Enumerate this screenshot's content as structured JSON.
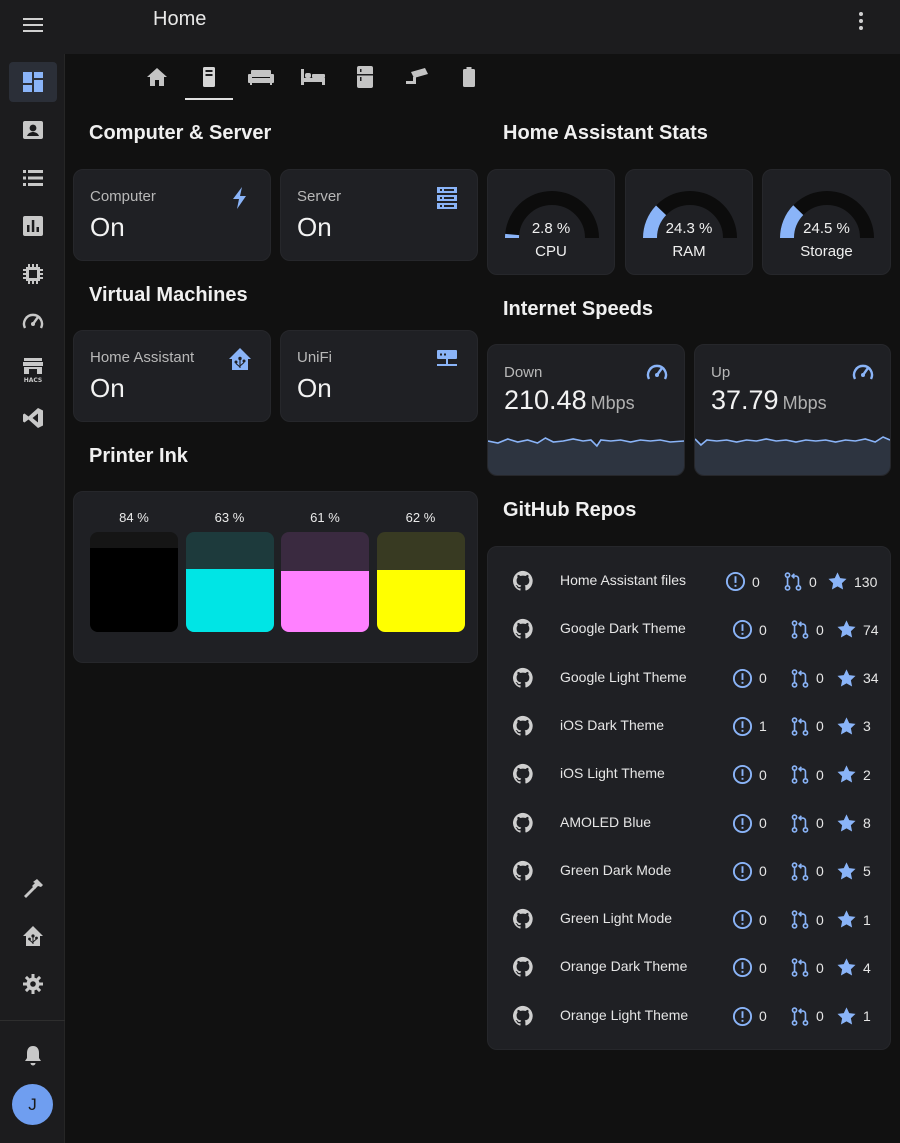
{
  "header": {
    "title": "Home",
    "menu_icon": "hamburger-menu-icon",
    "more_icon": "kebab-more-icon"
  },
  "sidebar": {
    "items": [
      {
        "icon": "dashboard-icon",
        "active": true
      },
      {
        "icon": "person-card-icon"
      },
      {
        "icon": "list-icon"
      },
      {
        "icon": "bar-chart-icon"
      },
      {
        "icon": "chip-icon"
      },
      {
        "icon": "speedometer-icon"
      },
      {
        "icon": "hacs-store-icon",
        "label": "HACS"
      },
      {
        "icon": "vscode-icon"
      }
    ],
    "bottom_items": [
      {
        "icon": "hammer-icon"
      },
      {
        "icon": "home-assistant-icon"
      },
      {
        "icon": "gear-icon"
      },
      {
        "icon": "bell-icon"
      }
    ],
    "avatar_initial": "J"
  },
  "tabs": [
    {
      "icon": "home-icon"
    },
    {
      "icon": "tower-pc-icon",
      "active": true
    },
    {
      "icon": "sofa-icon"
    },
    {
      "icon": "bed-icon"
    },
    {
      "icon": "fridge-icon"
    },
    {
      "icon": "cctv-icon"
    },
    {
      "icon": "battery-icon"
    }
  ],
  "computer_server": {
    "title": "Computer & Server",
    "tiles": [
      {
        "name": "Computer",
        "state": "On",
        "icon": "lightning-bolt-icon"
      },
      {
        "name": "Server",
        "state": "On",
        "icon": "server-icon"
      }
    ]
  },
  "virtual_machines": {
    "title": "Virtual Machines",
    "tiles": [
      {
        "name": "Home Assistant",
        "state": "On",
        "icon": "home-assistant-icon"
      },
      {
        "name": "UniFi",
        "state": "On",
        "icon": "network-icon"
      }
    ]
  },
  "printer_ink": {
    "title": "Printer Ink",
    "inks": [
      {
        "label": "84 %",
        "level": 0.84,
        "color": "#000000",
        "bg": "#151515"
      },
      {
        "label": "63 %",
        "level": 0.63,
        "color": "#00e5e5",
        "bg": "#1d3a3c"
      },
      {
        "label": "61 %",
        "level": 0.61,
        "color": "#ff80ff",
        "bg": "#3a2a40"
      },
      {
        "label": "62 %",
        "level": 0.62,
        "color": "#ffff00",
        "bg": "#383a22"
      }
    ]
  },
  "stats": {
    "title": "Home Assistant Stats",
    "gauges": [
      {
        "value_label": "2.8 %",
        "value": 2.8,
        "label": "CPU"
      },
      {
        "value_label": "24.3 %",
        "value": 24.3,
        "label": "RAM"
      },
      {
        "value_label": "24.5 %",
        "value": 24.5,
        "label": "Storage"
      }
    ]
  },
  "internet": {
    "title": "Internet Speeds",
    "speeds": [
      {
        "name": "Down",
        "value": "210.48",
        "unit": "Mbps",
        "icon": "speedometer-icon"
      },
      {
        "name": "Up",
        "value": "37.79",
        "unit": "Mbps",
        "icon": "speedometer-icon"
      }
    ]
  },
  "github": {
    "title": "GitHub Repos",
    "icons": {
      "repo": "github-icon",
      "issues": "alert-circle-icon",
      "prs": "pull-request-icon",
      "stars": "star-icon"
    },
    "repos": [
      {
        "name": "Home Assistant files",
        "issues": "0",
        "prs": "0",
        "stars": "130"
      },
      {
        "name": "Google Dark Theme",
        "issues": "0",
        "prs": "0",
        "stars": "74"
      },
      {
        "name": "Google Light Theme",
        "issues": "0",
        "prs": "0",
        "stars": "34"
      },
      {
        "name": "iOS Dark Theme",
        "issues": "1",
        "prs": "0",
        "stars": "3"
      },
      {
        "name": "iOS Light Theme",
        "issues": "0",
        "prs": "0",
        "stars": "2"
      },
      {
        "name": "AMOLED Blue",
        "issues": "0",
        "prs": "0",
        "stars": "8"
      },
      {
        "name": "Green Dark Mode",
        "issues": "0",
        "prs": "0",
        "stars": "5"
      },
      {
        "name": "Green Light Mode",
        "issues": "0",
        "prs": "0",
        "stars": "1"
      },
      {
        "name": "Orange Dark Theme",
        "issues": "0",
        "prs": "0",
        "stars": "4"
      },
      {
        "name": "Orange Light Theme",
        "issues": "0",
        "prs": "0",
        "stars": "1"
      }
    ]
  },
  "colors": {
    "accent": "#8ab4f8",
    "icon": "#c8c8c8",
    "card": "#1f2024",
    "background": "#111111"
  }
}
